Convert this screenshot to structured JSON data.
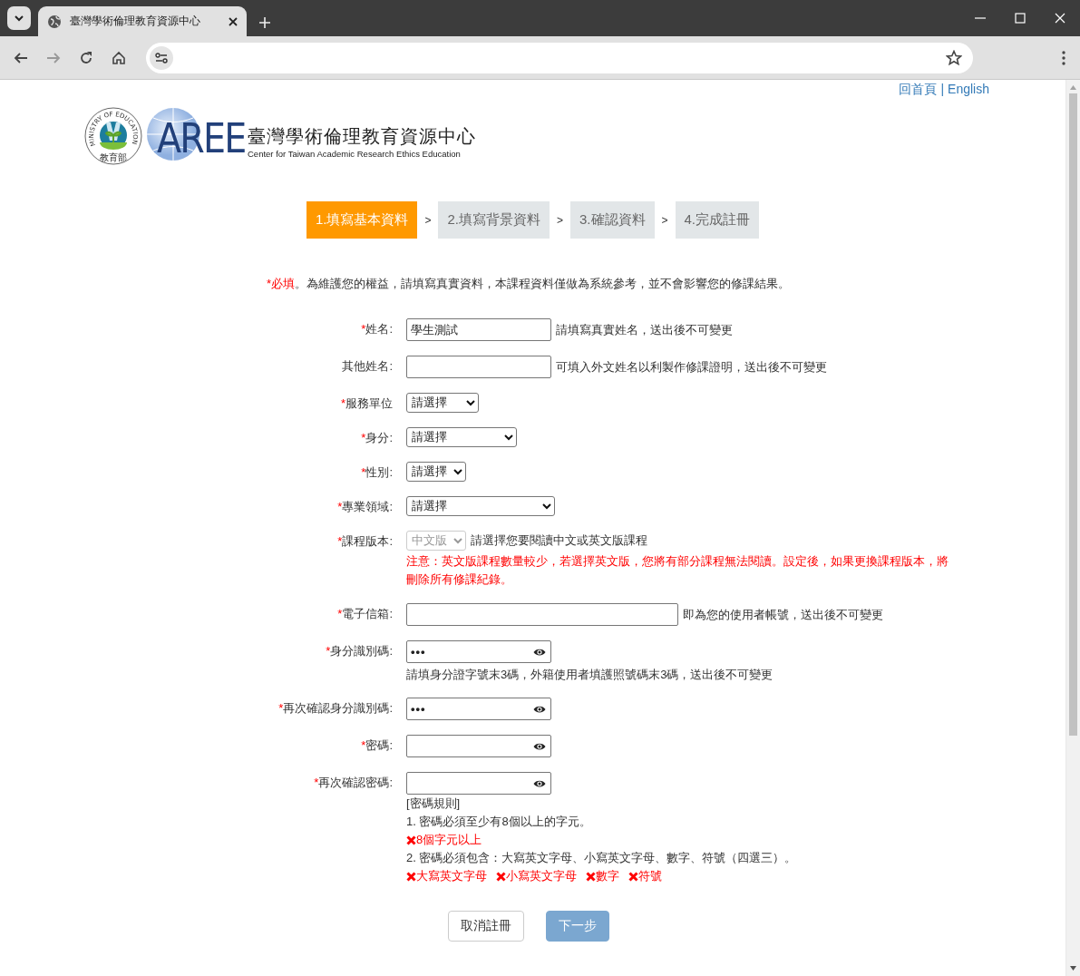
{
  "browser": {
    "tab_title": "臺灣學術倫理教育資源中心"
  },
  "top_links": [
    {
      "label": "回首頁"
    },
    {
      "label": "English"
    }
  ],
  "top_links_separator": "|",
  "logo": {
    "seal_text": "MINISTRY OF EDUCATION",
    "seal_bottom": "教育部",
    "mark": "AREE",
    "title": "臺灣學術倫理教育資源中心",
    "subtitle": "Center for Taiwan Academic Research Ethics Education"
  },
  "steps": [
    {
      "label": "1.填寫基本資料",
      "selected": true
    },
    {
      "label": "2.填寫背景資料",
      "selected": false
    },
    {
      "label": "3.確認資料",
      "selected": false
    },
    {
      "label": "4.完成註冊",
      "selected": false
    }
  ],
  "step_separators": [
    ">",
    ">",
    ">"
  ],
  "notice": {
    "required_mark": "*必填",
    "text": "。為維護您的權益，請填寫真實資料，本課程資料僅做為系統參考，並不會影響您的修課結果。"
  },
  "form": {
    "fields": [
      {
        "kind": "text",
        "marker": "*",
        "label": "姓名:",
        "value": "學生測試",
        "hint": "請填寫真實姓名，送出後不可變更"
      },
      {
        "kind": "text",
        "label": "其他姓名:",
        "hint": "可填入外文姓名以利製作修課證明，送出後不可變更"
      },
      {
        "kind": "select",
        "marker": "*",
        "label": "服務單位",
        "value": "請選擇"
      },
      {
        "kind": "select",
        "marker": "*",
        "label": "身分:",
        "value": "請選擇"
      },
      {
        "kind": "select",
        "marker": "*",
        "label": "性別:",
        "value": "請選擇"
      },
      {
        "kind": "select",
        "marker": "*",
        "label": "專業領域:",
        "value": "請選擇"
      },
      {
        "kind": "select",
        "marker": "*",
        "label": "課程版本:",
        "value": "中文版",
        "disabled": true,
        "hint": "請選擇您要閱讀中文或英文版課程",
        "warning": "注意：英文版課程數量較少，若選擇英文版，您將有部分課程無法閱讀。設定後，如果更換課程版本，將刪除所有修課紀錄。"
      },
      {
        "kind": "text",
        "marker": "*",
        "label": "電子信箱:",
        "hint": "即為您的使用者帳號，送出後不可變更"
      },
      {
        "kind": "password",
        "marker": "*",
        "label": "身分識別碼:",
        "value": "•••",
        "note": "請填身分證字號末3碼，外籍使用者填護照號碼末3碼，送出後不可變更"
      },
      {
        "kind": "password",
        "marker": "*",
        "label": "再次確認身分識別碼:",
        "value": "•••"
      },
      {
        "kind": "password",
        "marker": "*",
        "label": "密碼:"
      },
      {
        "kind": "password",
        "marker": "*",
        "label": "再次確認密碼:"
      }
    ],
    "password_rules": {
      "title": "[密碼規則]",
      "rules": [
        {
          "text": "1. 密碼必須至少有8個以上的字元。",
          "checks": [
            {
              "label": "8個字元以上",
              "met": false
            }
          ]
        },
        {
          "text": "2. 密碼必須包含：大寫英文字母、小寫英文字母、數字、符號（四選三）。",
          "checks": [
            {
              "label": "大寫英文字母",
              "met": false
            },
            {
              "label": "小寫英文字母",
              "met": false
            },
            {
              "label": "數字",
              "met": false
            },
            {
              "label": "符號",
              "met": false
            }
          ]
        }
      ]
    }
  },
  "buttons": [
    {
      "kind": "secondary",
      "label": "取消註冊",
      "disabled": false
    },
    {
      "kind": "primary",
      "label": "下一步",
      "disabled": true
    }
  ]
}
